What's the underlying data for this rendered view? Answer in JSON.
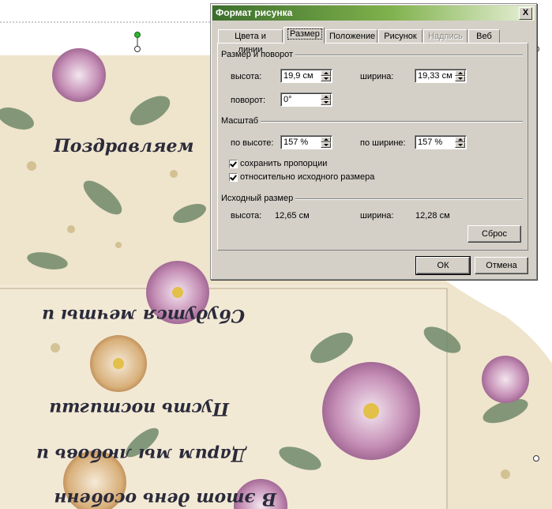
{
  "document": {
    "lines": [
      "Поздравляем",
      "Сбудутся мечты и",
      "Пусть постигши",
      "Дарим мы любовь и",
      "В этот день особенн"
    ]
  },
  "dialog": {
    "title": "Формат рисунка",
    "close_label": "X",
    "tabs": [
      {
        "label": "Цвета и линии",
        "state": "normal"
      },
      {
        "label": "Размер",
        "state": "active"
      },
      {
        "label": "Положение",
        "state": "normal"
      },
      {
        "label": "Рисунок",
        "state": "normal"
      },
      {
        "label": "Надпись",
        "state": "disabled"
      },
      {
        "label": "Веб",
        "state": "normal"
      }
    ],
    "size_rotate": {
      "title": "Размер и поворот",
      "height_label": "высота:",
      "height_value": "19,9 см",
      "width_label": "ширина:",
      "width_value": "19,33 см",
      "rotation_label": "поворот:",
      "rotation_value": "0°"
    },
    "scale": {
      "title": "Масштаб",
      "by_height_label": "по высоте:",
      "by_height_value": "157 %",
      "by_width_label": "по ширине:",
      "by_width_value": "157 %",
      "lock_aspect_label": "сохранить пропорции",
      "lock_aspect_checked": true,
      "relative_original_label": "относительно исходного размера",
      "relative_original_checked": true
    },
    "original_size": {
      "title": "Исходный размер",
      "height_label": "высота:",
      "height_value": "12,65 см",
      "width_label": "ширина:",
      "width_value": "12,28 см",
      "reset_label": "Сброс"
    },
    "ok_label": "ОК",
    "cancel_label": "Отмена"
  },
  "colors": {
    "title_gradient_start": "#3b6e2c",
    "dialog_face": "#d4d0c8"
  }
}
